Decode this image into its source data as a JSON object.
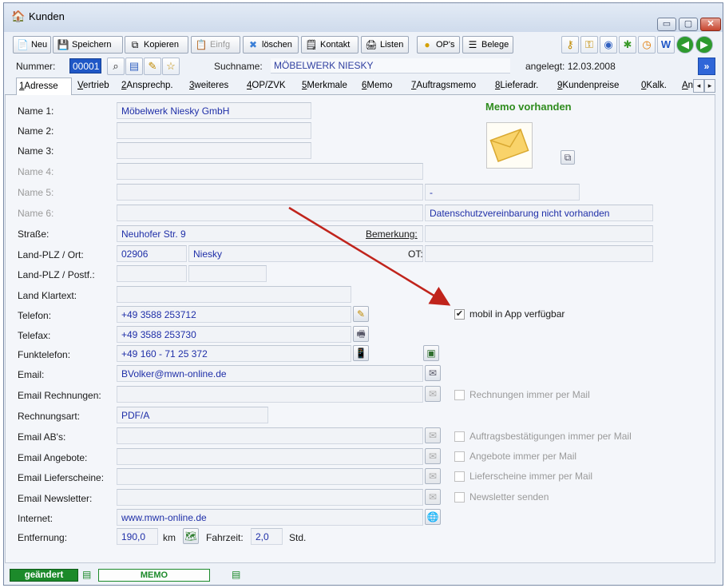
{
  "window": {
    "title": "Kunden",
    "min": "▭",
    "max": "▢",
    "close": "✕"
  },
  "toolbar": {
    "neu": "Neu",
    "speichern": "Speichern",
    "kopieren": "Kopieren",
    "einfg": "Einfg",
    "loeschen": "löschen",
    "kontakt": "Kontakt",
    "listen": "Listen",
    "ops": "OP's",
    "belege": "Belege"
  },
  "header": {
    "nummer_label": "Nummer:",
    "nummer_value": "00001",
    "suchname_label": "Suchname:",
    "suchname_value": "MÖBELWERK NIESKY",
    "angelegt": "angelegt: 12.03.2008"
  },
  "tabs": [
    {
      "key": "1",
      "label": "Adresse"
    },
    {
      "key": "V",
      "label": "ertrieb"
    },
    {
      "key": "2",
      "label": "Ansprechp."
    },
    {
      "key": "3",
      "label": "weiteres"
    },
    {
      "key": "4",
      "label": "OP/ZVK"
    },
    {
      "key": "5",
      "label": "Merkmale"
    },
    {
      "key": "6",
      "label": "Memo"
    },
    {
      "key": "7",
      "label": "Auftragsmemo"
    },
    {
      "key": "8",
      "label": "Lieferadr."
    },
    {
      "key": "9",
      "label": "Kundenpreise"
    },
    {
      "key": "0",
      "label": "Kalk."
    },
    {
      "key": "A",
      "label": "n"
    }
  ],
  "labels": {
    "name1": "Name 1:",
    "name2": "Name 2:",
    "name3": "Name 3:",
    "name4": "Name 4:",
    "name5": "Name 5:",
    "name6": "Name 6:",
    "strasse": "Straße:",
    "land_plz_ort": "Land-PLZ / Ort:",
    "land_plz_postf": "Land-PLZ / Postf.:",
    "land_klartext": "Land Klartext:",
    "telefon": "Telefon:",
    "telefax": "Telefax:",
    "funktelefon": "Funktelefon:",
    "email": "Email:",
    "email_rechnungen": "Email Rechnungen:",
    "rechnungsart": "Rechnungsart:",
    "email_ab": "Email AB's:",
    "email_angebote": "Email Angebote:",
    "email_lieferscheine": "Email Lieferscheine:",
    "email_newsletter": "Email Newsletter:",
    "internet": "Internet:",
    "entfernung": "Entfernung:",
    "bemerkung": "Bemerkung:",
    "ot": "OT:",
    "km": "km",
    "fahrzeit": "Fahrzeit:",
    "std": "Std."
  },
  "values": {
    "name1": "Möbelwerk Niesky GmbH",
    "strasse": "Neuhofer Str. 9",
    "plz": "02906",
    "ort": "Niesky",
    "telefon": "+49 3588 253712",
    "telefax": "+49 3588 253730",
    "funktelefon": "+49 160 - 71 25 372",
    "email": "BVolker@mwn-online.de",
    "rechnungsart": "PDF/A",
    "internet": "www.mwn-online.de",
    "entfernung": "190,0",
    "fahrzeit": "2,0",
    "name5_side": "-",
    "datenschutz": "Datenschutzvereinbarung nicht vorhanden"
  },
  "memo": {
    "title": "Memo vorhanden"
  },
  "checkboxes": {
    "mobil_app": {
      "label": "mobil in App verfügbar",
      "checked": true
    },
    "rechnungen_mail": {
      "label": "Rechnungen immer per Mail",
      "checked": false
    },
    "ab_mail": {
      "label": "Auftragsbestätigungen immer per Mail",
      "checked": false
    },
    "angebote_mail": {
      "label": "Angebote immer per Mail",
      "checked": false
    },
    "lieferscheine_mail": {
      "label": "Lieferscheine immer per Mail",
      "checked": false
    },
    "newsletter": {
      "label": "Newsletter senden",
      "checked": false
    }
  },
  "status": {
    "changed": "geändert",
    "memo": "MEMO"
  },
  "colors": {
    "accent_blue": "#1f57c6",
    "value_text": "#1f2fa8",
    "memo_green": "#2f8c1e",
    "arrow_red": "#c0241c"
  }
}
